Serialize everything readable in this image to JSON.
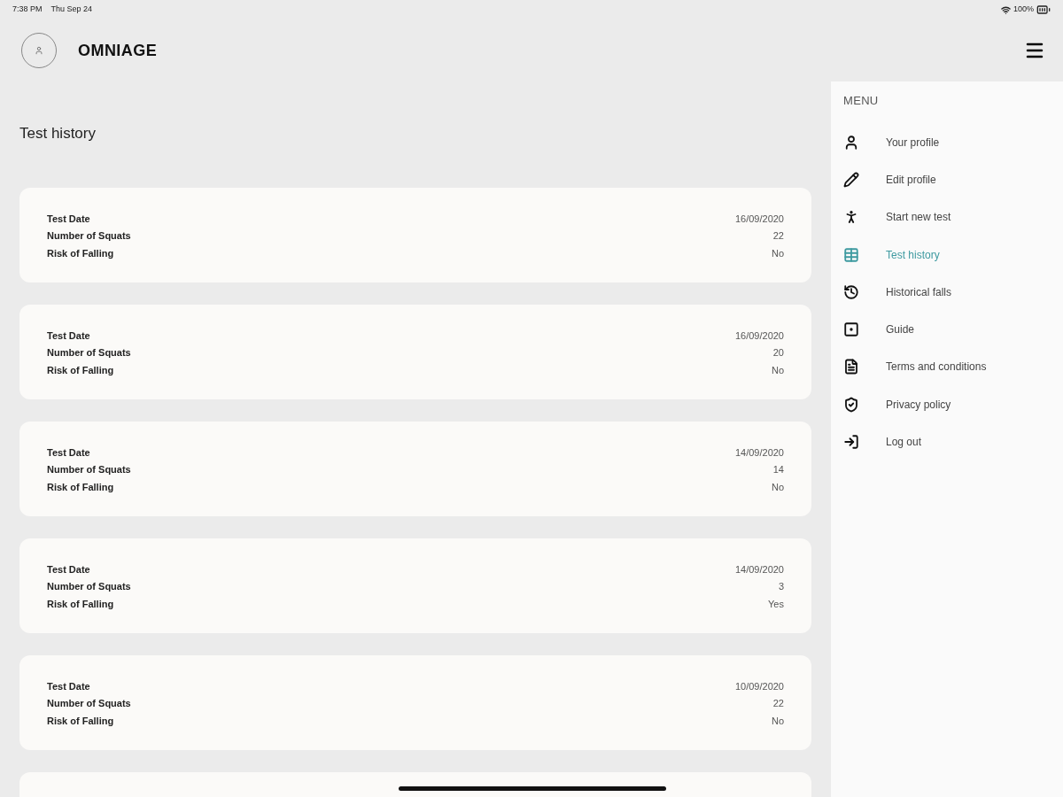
{
  "status_bar": {
    "time": "7:38 PM",
    "date": "Thu Sep 24",
    "battery": "100%"
  },
  "header": {
    "app_name": "OMNIAGE"
  },
  "page_title": "Test history",
  "tests": [
    {
      "labels": [
        "Test Date",
        "Number of Squats",
        "Risk of Falling"
      ],
      "values": [
        "16/09/2020",
        "22",
        "No"
      ]
    },
    {
      "labels": [
        "Test Date",
        "Number of Squats",
        "Risk of Falling"
      ],
      "values": [
        "16/09/2020",
        "20",
        "No"
      ]
    },
    {
      "labels": [
        "Test Date",
        "Number of Squats",
        "Risk of Falling"
      ],
      "values": [
        "14/09/2020",
        "14",
        "No"
      ]
    },
    {
      "labels": [
        "Test Date",
        "Number of Squats",
        "Risk of Falling"
      ],
      "values": [
        "14/09/2020",
        "3",
        "Yes"
      ]
    },
    {
      "labels": [
        "Test Date",
        "Number of Squats",
        "Risk of Falling"
      ],
      "values": [
        "10/09/2020",
        "22",
        "No"
      ]
    }
  ],
  "menu": {
    "title": "MENU",
    "items": [
      {
        "kind": "profile",
        "label": "Your profile",
        "selected": false
      },
      {
        "kind": "edit",
        "label": "Edit profile",
        "selected": false
      },
      {
        "kind": "test",
        "label": "Start new test",
        "selected": false
      },
      {
        "kind": "history",
        "label": "Test history",
        "selected": true
      },
      {
        "kind": "falls",
        "label": "Historical falls",
        "selected": false
      },
      {
        "kind": "guide",
        "label": "Guide",
        "selected": false
      },
      {
        "kind": "terms",
        "label": "Terms and conditions",
        "selected": false
      },
      {
        "kind": "privacy",
        "label": "Privacy policy",
        "selected": false
      },
      {
        "kind": "logout",
        "label": "Log out",
        "selected": false
      }
    ]
  }
}
